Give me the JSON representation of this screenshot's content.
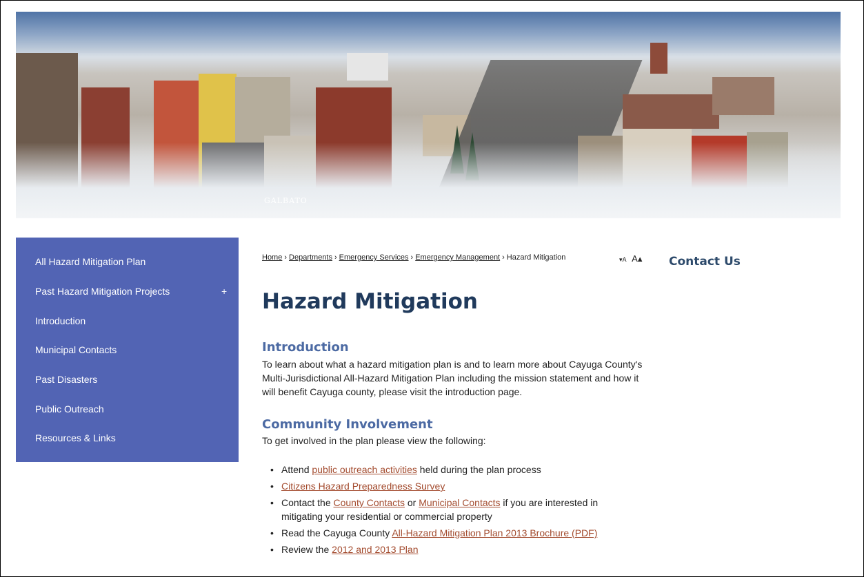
{
  "banner": {
    "alt_caption": "GALBATO"
  },
  "sidebar": {
    "items": [
      {
        "label": "All Hazard Mitigation Plan"
      },
      {
        "label": "Past Hazard Mitigation Projects",
        "expand": "+"
      },
      {
        "label": "Introduction"
      },
      {
        "label": "Municipal Contacts"
      },
      {
        "label": "Past Disasters"
      },
      {
        "label": "Public Outreach"
      },
      {
        "label": "Resources & Links"
      }
    ]
  },
  "breadcrumb": {
    "items": [
      "Home",
      "Departments",
      "Emergency Services",
      "Emergency Management"
    ],
    "current": "Hazard Mitigation",
    "separator": "›"
  },
  "font_controls": {
    "decrease": "▾A",
    "increase": "A▴"
  },
  "aside": {
    "contact_title": "Contact Us"
  },
  "page": {
    "title": "Hazard Mitigation",
    "introduction": {
      "heading": "Introduction",
      "text": "To learn about what a hazard mitigation plan is and to learn more about Cayuga County's Multi-Jurisdictional All-Hazard Mitigation Plan including the mission statement and how it will benefit Cayuga county, please visit the introduction page."
    },
    "community": {
      "heading": "Community Involvement",
      "intro": "To get involved in the plan please view the following:",
      "items": [
        {
          "pre": "Attend ",
          "link": "public outreach activities",
          "post": " held during the plan process"
        },
        {
          "pre": "",
          "link": "Citizens Hazard Preparedness Survey",
          "post": ""
        },
        {
          "pre": "Contact the ",
          "link": "County Contacts",
          "mid": " or ",
          "link2": "Municipal Contacts",
          "post": " if you are interested in mitigating your residential or commercial property"
        },
        {
          "pre": "Read the Cayuga County ",
          "link": "All-Hazard Mitigation Plan 2013 Brochure (PDF)",
          "post": ""
        },
        {
          "pre": "Review the ",
          "link": "2012 and 2013 Plan",
          "post": ""
        }
      ]
    }
  },
  "colors": {
    "sidebar_bg": "#5264b4",
    "title": "#203a5c",
    "heading": "#4c6aa3",
    "link": "#a34b2e"
  }
}
